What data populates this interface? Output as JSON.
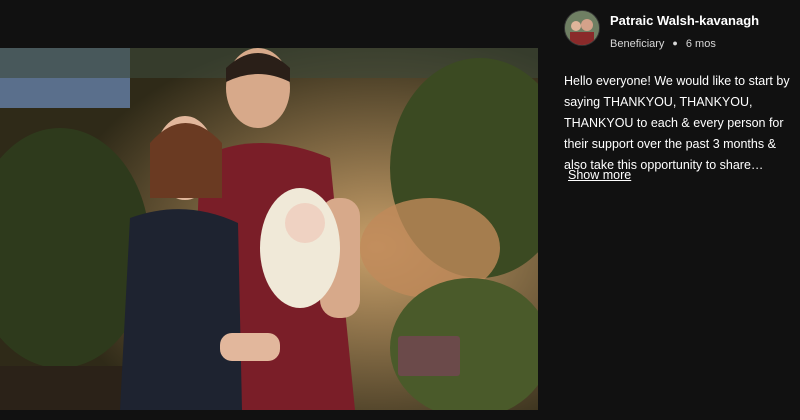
{
  "post": {
    "author_name": "Patraic Walsh-kavanagh",
    "role": "Beneficiary",
    "time_ago": "6 mos",
    "text": "Hello everyone! We would like to start by saying THANKYOU, THANKYOU, THANKYOU to each & every person for their support over the past 3 months & also take this opportunity to share…",
    "show_more_label": "Show more"
  },
  "icons": {
    "avatar": "profile-photo",
    "photo": "family-photo"
  }
}
